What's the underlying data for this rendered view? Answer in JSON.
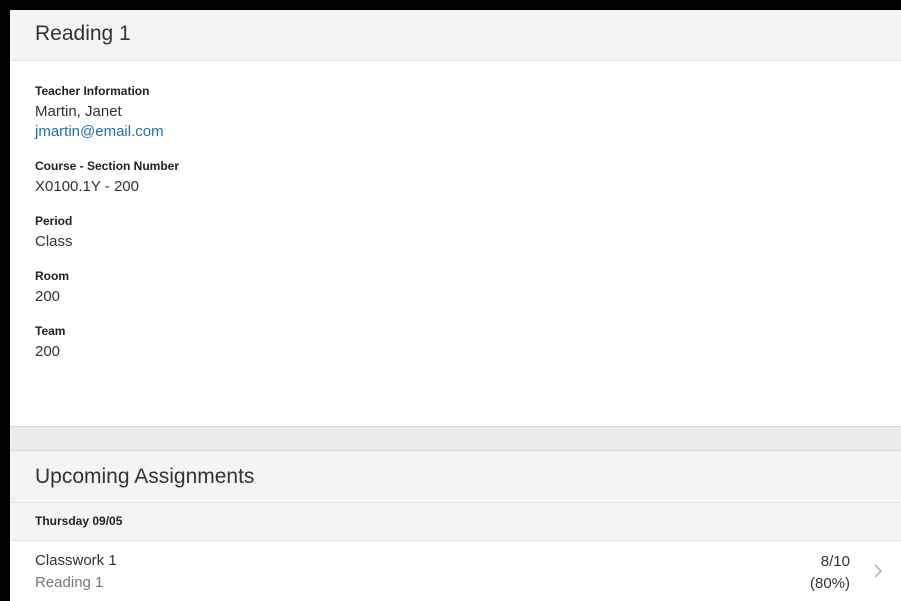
{
  "course_card": {
    "title": "Reading 1",
    "fields": {
      "teacher_label": "Teacher Information",
      "teacher_name": "Martin, Janet",
      "teacher_email": "jmartin@email.com",
      "section_label": "Course - Section Number",
      "section_value": "X0100.1Y - 200",
      "period_label": "Period",
      "period_value": "Class",
      "room_label": "Room",
      "room_value": "200",
      "team_label": "Team",
      "team_value": "200"
    }
  },
  "assignments_card": {
    "title": "Upcoming Assignments",
    "day_header": "Thursday 09/05",
    "items": [
      {
        "name": "Classwork 1",
        "course": "Reading 1",
        "score": "8/10",
        "percent": "(80%)"
      }
    ]
  },
  "icons": {
    "row_chevron": "chevron-right-icon"
  },
  "colors": {
    "link": "#1f6fb2",
    "header_bg": "#f4f4f4",
    "page_bg": "#ececec"
  }
}
